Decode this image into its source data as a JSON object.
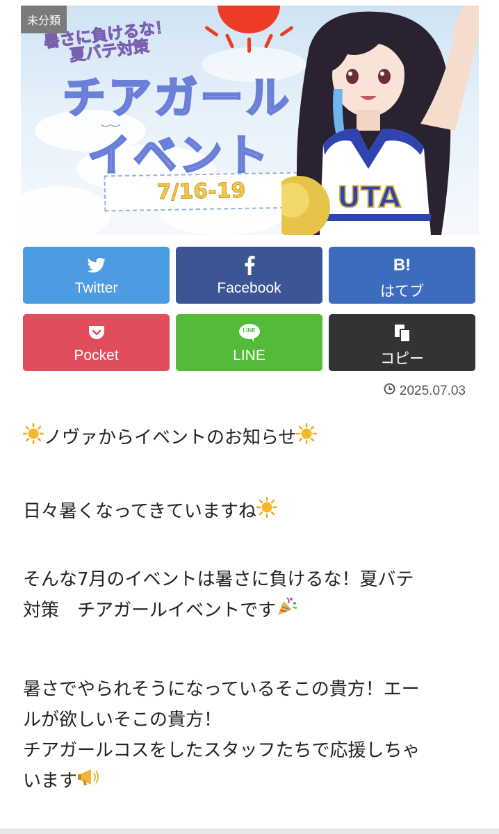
{
  "banner": {
    "category_badge": "未分類",
    "subtitle_line1": "暑さに負けるな！",
    "subtitle_line2": "夏バテ対策",
    "title_line1": "チアガール",
    "title_line2": "イベント",
    "date_range": "7/16-19",
    "uniform_text": "UTA"
  },
  "share": {
    "buttons": [
      {
        "label": "Twitter",
        "icon": "twitter-bird-icon"
      },
      {
        "label": "Facebook",
        "icon": "facebook-f-icon"
      },
      {
        "label": "はてブ",
        "icon": "hatena-bookmark-icon",
        "icon_text": "B!"
      },
      {
        "label": "Pocket",
        "icon": "pocket-icon"
      },
      {
        "label": "LINE",
        "icon": "line-icon",
        "icon_text": "LINE"
      },
      {
        "label": "コピー",
        "icon": "copy-icon"
      }
    ],
    "colors": {
      "twitter": "#4d9be0",
      "facebook": "#3c5594",
      "hatena": "#3d6cbf",
      "pocket": "#e14d5a",
      "line": "#53ba3a",
      "copy": "#333333"
    }
  },
  "post": {
    "date": "2025.07.03",
    "p1": "ノヴァからイベントのお知らせ",
    "p2": "日々暑くなってきていますね",
    "p3_line1": "そんな7月のイベントは暑さに負けるな！夏バテ",
    "p3_line2": "対策　チアガールイベントです",
    "p4_line1": "暑さでやられそうになっているそこの貴方！エー",
    "p4_line2": "ルが欲しいそこの貴方！",
    "p4_line3": "チアガールコスをしたスタッフたちで応援しちゃ",
    "p4_line4": "います"
  }
}
